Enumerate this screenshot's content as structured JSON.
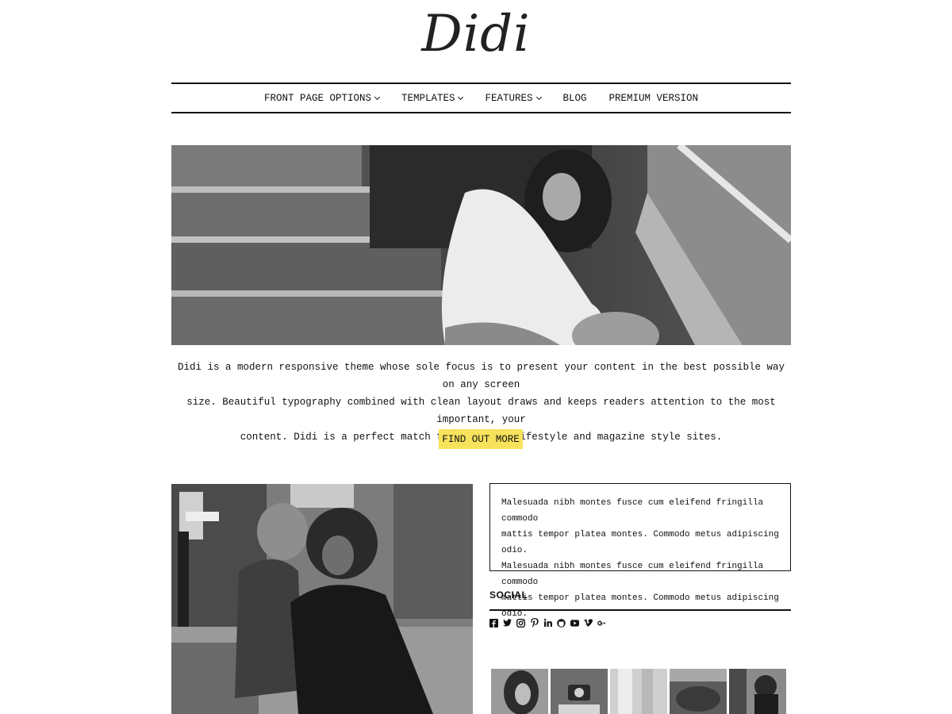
{
  "site": {
    "title": "Didi"
  },
  "nav": {
    "items": [
      {
        "label": "FRONT PAGE OPTIONS",
        "dropdown": true
      },
      {
        "label": "TEMPLATES",
        "dropdown": true
      },
      {
        "label": "FEATURES",
        "dropdown": true
      },
      {
        "label": "BLOG",
        "dropdown": false
      },
      {
        "label": "PREMIUM VERSION",
        "dropdown": false
      }
    ]
  },
  "intro": {
    "line1": "Didi is a modern responsive theme whose sole focus is to present your content in the best possible way on any screen",
    "line2": "size. Beautiful typography combined with clean layout draws and keeps readers attention to the most important, your",
    "line3": "content. Didi is a perfect match for fashion, lifestyle and magazine style sites.",
    "button_label": "FIND OUT MORE"
  },
  "colors": {
    "accent": "#f7e25c",
    "text": "#111111"
  },
  "sidebar": {
    "text_widget": {
      "line1": "Malesuada nibh montes fusce cum eleifend fringilla commodo",
      "line2": "mattis tempor platea montes. Commodo metus adipiscing odio.",
      "line3": "Malesuada nibh montes fusce cum eleifend fringilla commodo",
      "line4": "mattis tempor platea montes. Commodo metus adipiscing odio."
    },
    "social": {
      "title": "SOCIAL",
      "icons": [
        "facebook-icon",
        "twitter-icon",
        "instagram-icon",
        "pinterest-icon",
        "linkedin-icon",
        "github-icon",
        "youtube-icon",
        "vimeo-icon",
        "google-plus-icon"
      ]
    }
  }
}
